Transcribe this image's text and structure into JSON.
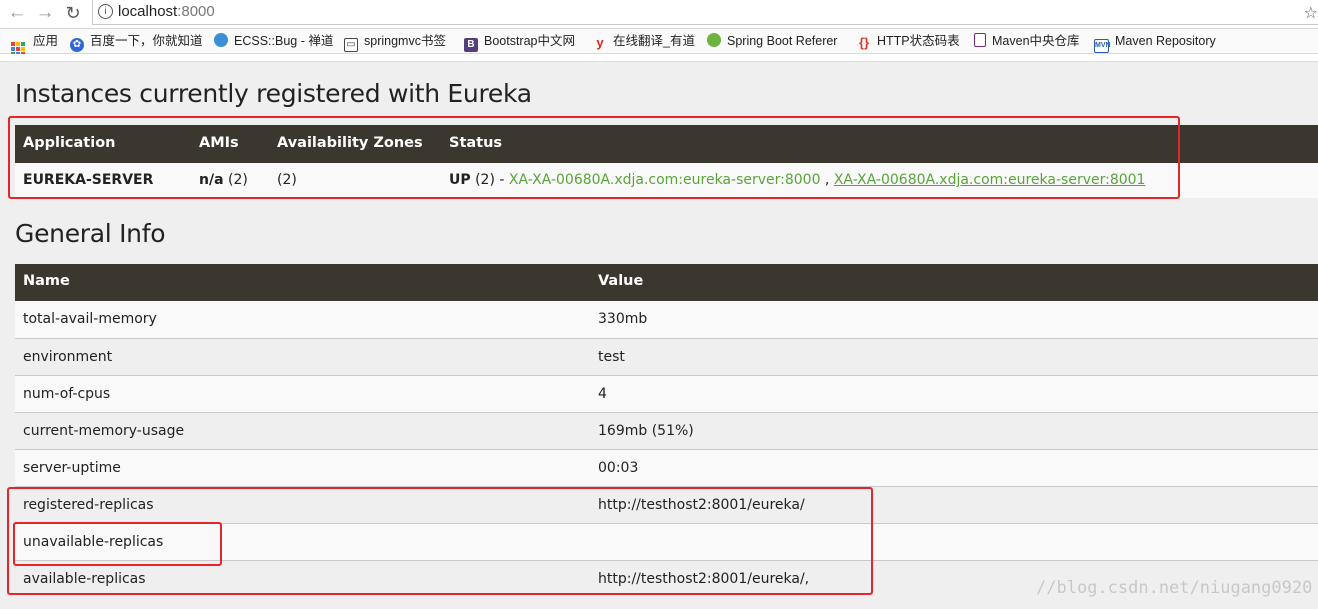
{
  "browser": {
    "url_host": "localhost",
    "url_port": ":8000",
    "info_glyph": "i",
    "bookmarks": [
      {
        "label": "应用",
        "icon": "apps-icon"
      },
      {
        "label": "百度一下，你就知道",
        "icon": "baidu-paw-icon"
      },
      {
        "label": "ECSS::Bug - 禅道",
        "icon": "globe-icon"
      },
      {
        "label": "springmvc书签",
        "icon": "book-icon"
      },
      {
        "label": "Bootstrap中文网",
        "icon": "bootstrap-icon"
      },
      {
        "label": "在线翻译_有道",
        "icon": "youdao-icon"
      },
      {
        "label": "Spring Boot Referer",
        "icon": "spring-icon"
      },
      {
        "label": "HTTP状态码表",
        "icon": "braces-icon"
      },
      {
        "label": "Maven中央仓库",
        "icon": "bookmark-icon"
      },
      {
        "label": "Maven Repository",
        "icon": "mvn-icon"
      }
    ]
  },
  "instances": {
    "title": "Instances currently registered with Eureka",
    "headers": [
      "Application",
      "AMIs",
      "Availability Zones",
      "Status"
    ],
    "row": {
      "application": "EUREKA-SERVER",
      "amis_label": "n/a",
      "amis_count": " (2)",
      "zones": "(2)",
      "status_prefix": "UP",
      "status_count": " (2) - ",
      "link1": "XA-XA-00680A.xdja.com:eureka-server:8000",
      "separator": " , ",
      "link2": "XA-XA-00680A.xdja.com:eureka-server:8001"
    }
  },
  "general_info": {
    "title": "General Info",
    "headers": [
      "Name",
      "Value"
    ],
    "rows": [
      {
        "name": "total-avail-memory",
        "value": "330mb"
      },
      {
        "name": "environment",
        "value": "test"
      },
      {
        "name": "num-of-cpus",
        "value": "4"
      },
      {
        "name": "current-memory-usage",
        "value": "169mb (51%)"
      },
      {
        "name": "server-uptime",
        "value": "00:03"
      },
      {
        "name": "registered-replicas",
        "value": "http://testhost2:8001/eureka/"
      },
      {
        "name": "unavailable-replicas",
        "value": ""
      },
      {
        "name": "available-replicas",
        "value": "http://testhost2:8001/eureka/,"
      }
    ]
  },
  "watermark": "//blog.csdn.net/niugang0920",
  "colors": {
    "header_bg": "#3b362e",
    "link": "#5aa33a",
    "highlight_box": "#e4252a"
  }
}
